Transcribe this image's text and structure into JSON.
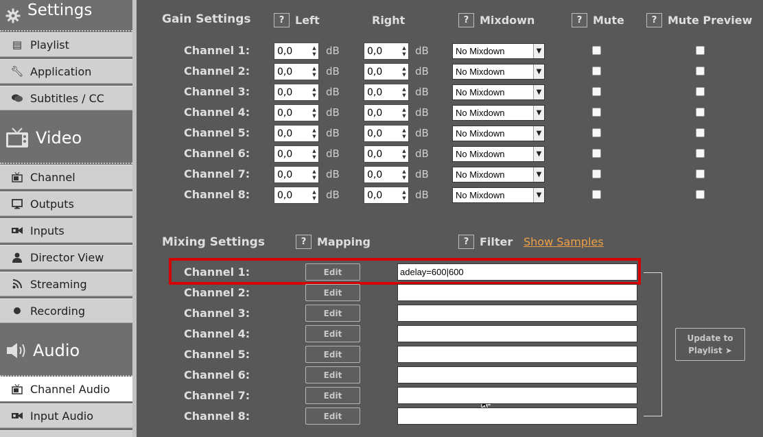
{
  "sidebar": {
    "settings_title": "Settings",
    "settings_items": [
      "Playlist",
      "Application",
      "Subtitles / CC"
    ],
    "video_title": "Video",
    "video_items": [
      "Channel",
      "Outputs",
      "Inputs",
      "Director View",
      "Streaming",
      "Recording"
    ],
    "audio_title": "Audio",
    "audio_items": [
      "Channel Audio",
      "Input Audio"
    ],
    "active_item": "Channel Audio"
  },
  "gain": {
    "title": "Gain Settings",
    "help": "?",
    "col_left": "Left",
    "col_right": "Right",
    "col_mixdown": "Mixdown",
    "col_mute": "Mute",
    "col_mute_preview": "Mute Preview",
    "unit": "dB",
    "channels": [
      {
        "label": "Channel 1:",
        "left": "0,0",
        "right": "0,0",
        "mixdown": "No Mixdown",
        "mute": false,
        "mute_preview": false
      },
      {
        "label": "Channel 2:",
        "left": "0,0",
        "right": "0,0",
        "mixdown": "No Mixdown",
        "mute": false,
        "mute_preview": false
      },
      {
        "label": "Channel 3:",
        "left": "0,0",
        "right": "0,0",
        "mixdown": "No Mixdown",
        "mute": false,
        "mute_preview": false
      },
      {
        "label": "Channel 4:",
        "left": "0,0",
        "right": "0,0",
        "mixdown": "No Mixdown",
        "mute": false,
        "mute_preview": false
      },
      {
        "label": "Channel 5:",
        "left": "0,0",
        "right": "0,0",
        "mixdown": "No Mixdown",
        "mute": false,
        "mute_preview": false
      },
      {
        "label": "Channel 6:",
        "left": "0,0",
        "right": "0,0",
        "mixdown": "No Mixdown",
        "mute": false,
        "mute_preview": false
      },
      {
        "label": "Channel 7:",
        "left": "0,0",
        "right": "0,0",
        "mixdown": "No Mixdown",
        "mute": false,
        "mute_preview": false
      },
      {
        "label": "Channel 8:",
        "left": "0,0",
        "right": "0,0",
        "mixdown": "No Mixdown",
        "mute": false,
        "mute_preview": false
      }
    ]
  },
  "mixing": {
    "title": "Mixing Settings",
    "help": "?",
    "col_mapping": "Mapping",
    "col_filter": "Filter",
    "show_samples": "Show Samples",
    "edit_label": "Edit",
    "update_line1": "Update to",
    "update_line2": "Playlist ➤",
    "channels": [
      {
        "label": "Channel 1:",
        "filter": "adelay=600|600"
      },
      {
        "label": "Channel 2:",
        "filter": ""
      },
      {
        "label": "Channel 3:",
        "filter": ""
      },
      {
        "label": "Channel 4:",
        "filter": ""
      },
      {
        "label": "Channel 5:",
        "filter": ""
      },
      {
        "label": "Channel 6:",
        "filter": ""
      },
      {
        "label": "Channel 7:",
        "filter": ""
      },
      {
        "label": "Channel 8:",
        "filter": ""
      }
    ]
  },
  "colors": {
    "highlight": "#d50000",
    "link": "#f0a046",
    "panel_bg": "#585858",
    "nav_bg": "#d0d0d0"
  }
}
